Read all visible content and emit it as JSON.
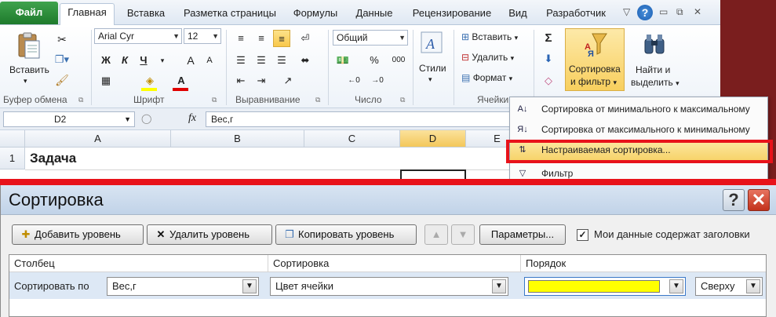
{
  "tabs": {
    "file": "Файл",
    "home": "Главная",
    "insert": "Вставка",
    "layout": "Разметка страницы",
    "formulas": "Формулы",
    "data": "Данные",
    "review": "Рецензирование",
    "view": "Вид",
    "developer": "Разработчик"
  },
  "ribbon": {
    "paste": "Вставить",
    "clipboard_group": "Буфер обмена",
    "font_name": "Arial Cyr",
    "font_size": "12",
    "font_group": "Шрифт",
    "bold": "Ж",
    "italic": "К",
    "underline": "Ч",
    "grow": "A",
    "shrink": "A",
    "font_color": "A",
    "align_group": "Выравнивание",
    "number_format": "Общий",
    "percent": "%",
    "thousands": "000",
    "number_group": "Число",
    "styles": "Стили",
    "insert_cells": "Вставить",
    "delete_cells": "Удалить",
    "format_cells": "Формат",
    "cells_group": "Ячейки",
    "sum": "Σ",
    "sort_filter_l1": "Сортировка",
    "sort_filter_l2": "и фильтр",
    "find_l1": "Найти и",
    "find_l2": "выделить"
  },
  "formula_bar": {
    "cell_ref": "D2",
    "fx": "fx",
    "value": "Вес,г"
  },
  "grid": {
    "columns": [
      "A",
      "B",
      "C",
      "D",
      "E"
    ],
    "row1_num": "1",
    "a1": "Задача"
  },
  "sort_menu": {
    "items": [
      {
        "icon": "А↓",
        "label": "Сортировка от минимального к максимальному"
      },
      {
        "icon": "Я↓",
        "label": "Сортировка от максимального к минимальному"
      },
      {
        "icon": "⇅",
        "label": "Настраиваемая сортировка..."
      },
      {
        "icon": "▽",
        "label": "Фильтр"
      }
    ]
  },
  "dialog": {
    "title": "Сортировка",
    "help": "?",
    "close": "✕",
    "add_level": "Добавить уровень",
    "delete_level": "Удалить уровень",
    "copy_level": "Копировать уровень",
    "up": "▲",
    "down": "▼",
    "options": "Параметры...",
    "has_headers": "Мои данные содержат заголовки",
    "has_headers_checked": "✓",
    "col_header": "Столбец",
    "sort_header": "Сортировка",
    "order_header": "Порядок",
    "sort_by_label": "Сортировать по",
    "column_value": "Вес,г",
    "sort_on_value": "Цвет ячейки",
    "order_value": "Сверху",
    "order_color": "#ffff00"
  }
}
